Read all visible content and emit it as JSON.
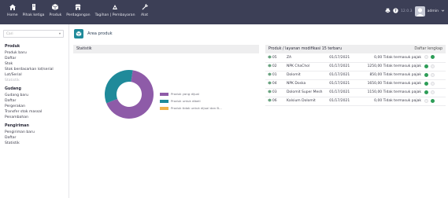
{
  "topbar": {
    "nav": [
      {
        "icon": "home-icon",
        "label": "Home"
      },
      {
        "icon": "building-icon",
        "label": "Pihak ketiga"
      },
      {
        "icon": "cube-icon",
        "label": "Produk"
      },
      {
        "icon": "shop-icon",
        "label": "Perdagangan"
      },
      {
        "icon": "money-icon",
        "label": "Tagihan | Pembayaran"
      },
      {
        "icon": "wrench-icon",
        "label": "Alat"
      }
    ],
    "user": {
      "label": "admin"
    }
  },
  "sidebar": {
    "search_placeholder": "Cari",
    "groups": [
      {
        "title": "Produk",
        "items": [
          {
            "label": "Produk baru",
            "muted": false
          },
          {
            "label": "Daftar",
            "muted": false
          },
          {
            "label": "Stok",
            "muted": false
          },
          {
            "label": "Stok berdasarkan lot/serial",
            "muted": false
          },
          {
            "label": "Lot/Serial",
            "muted": false
          },
          {
            "label": "Statistik",
            "muted": true
          }
        ]
      },
      {
        "title": "Gudang",
        "items": [
          {
            "label": "Gudang baru",
            "muted": false
          },
          {
            "label": "Daftar",
            "muted": false
          },
          {
            "label": "Pergerakan",
            "muted": false
          },
          {
            "label": "Transfer stok massal",
            "muted": false
          },
          {
            "label": "Penambahan",
            "muted": false
          }
        ]
      },
      {
        "title": "Pengiriman",
        "items": [
          {
            "label": "Pengiriman baru",
            "muted": false
          },
          {
            "label": "Daftar",
            "muted": false
          },
          {
            "label": "Statistik",
            "muted": false
          }
        ]
      }
    ]
  },
  "main": {
    "page_title": "Area produk",
    "stats": {
      "title": "Statistik",
      "legend": [
        {
          "label": "Produk yang dijual",
          "color": "#8e5ba8"
        },
        {
          "label": "Produk untuk dibeli",
          "color": "#1f8a9a"
        },
        {
          "label": "Produk tidak untuk dijual dan B...",
          "color": "#f0b24a"
        }
      ]
    },
    "list": {
      "title": "Produk / layanan modifikasi 15 terbaru",
      "right_label": "Daftar lengkap",
      "rows": [
        {
          "ref": "05",
          "name": "ZA",
          "date": "01/17/2021",
          "amount": "0,00 Tidak termasuk pajak",
          "sell": false,
          "buy": true
        },
        {
          "ref": "02",
          "name": "NPK ChaChol",
          "date": "01/17/2021",
          "amount": "1250,00 Tidak termasuk pajak",
          "sell": true,
          "buy": false
        },
        {
          "ref": "01",
          "name": "Dolomit",
          "date": "01/17/2021",
          "amount": "850,00 Tidak termasuk pajak",
          "sell": true,
          "buy": false
        },
        {
          "ref": "04",
          "name": "NPK Doska",
          "date": "01/17/2021",
          "amount": "1650,00 Tidak termasuk pajak",
          "sell": true,
          "buy": false
        },
        {
          "ref": "03",
          "name": "Dolomit Super Mesh",
          "date": "01/17/2021",
          "amount": "1150,00 Tidak termasuk pajak",
          "sell": true,
          "buy": false
        },
        {
          "ref": "06",
          "name": "Kalsium Dolomit",
          "date": "01/17/2021",
          "amount": "0,00 Tidak termasuk pajak",
          "sell": false,
          "buy": true
        }
      ]
    }
  },
  "chart_data": {
    "type": "pie",
    "categories": [
      "Produk yang dijual",
      "Produk untuk dibeli",
      "Produk tidak untuk dijual dan B..."
    ],
    "values": [
      4,
      2,
      0
    ],
    "colors": [
      "#8e5ba8",
      "#1f8a9a",
      "#f0b24a"
    ]
  }
}
